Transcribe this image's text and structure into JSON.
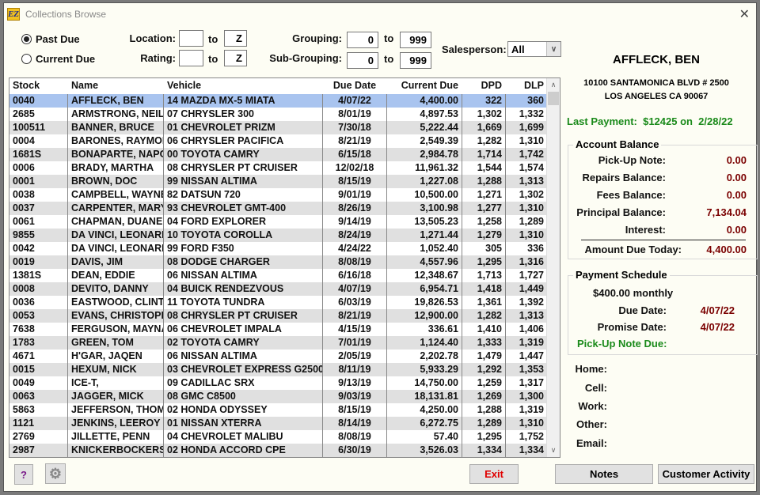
{
  "window": {
    "title": "Collections Browse",
    "logo_text": "EZ",
    "close": "✕"
  },
  "filters": {
    "past_due": "Past Due",
    "current_due": "Current Due",
    "selected": "past_due",
    "location_label": "Location:",
    "location_from": "",
    "location_to": "Z",
    "rating_label": "Rating:",
    "rating_from": "",
    "rating_to": "Z",
    "to": "to",
    "grouping_label": "Grouping:",
    "grouping_from": "0",
    "grouping_to": "999",
    "subgrouping_label": "Sub-Grouping:",
    "subgrouping_from": "0",
    "subgrouping_to": "999",
    "salesperson_label": "Salesperson:",
    "salesperson_value": "All"
  },
  "table": {
    "columns": [
      "Stock",
      "Name",
      "Vehicle",
      "Due Date",
      "Current Due",
      "DPD",
      "DLP"
    ],
    "selected_index": 0,
    "rows": [
      [
        "0040",
        "AFFLECK, BEN",
        "14 MAZDA MX-5 MIATA",
        "4/07/22",
        "4,400.00",
        "322",
        "360"
      ],
      [
        "2685",
        "ARMSTRONG, NEIL",
        "07 CHRYSLER 300",
        "8/01/19",
        "4,897.53",
        "1,302",
        "1,332"
      ],
      [
        "100511",
        "BANNER, BRUCE",
        "01 CHEVROLET PRIZM",
        "7/30/18",
        "5,222.44",
        "1,669",
        "1,699"
      ],
      [
        "0004",
        "BARONES, RAYMOND",
        "06 CHRYSLER PACIFICA",
        "8/21/19",
        "2,549.39",
        "1,282",
        "1,310"
      ],
      [
        "1681S",
        "BONAPARTE, NAPOLEON",
        "00 TOYOTA CAMRY",
        "6/15/18",
        "2,984.78",
        "1,714",
        "1,742"
      ],
      [
        "0006",
        "BRADY, MARTHA",
        "08 CHRYSLER PT CRUISER",
        "12/02/18",
        "11,961.32",
        "1,544",
        "1,574"
      ],
      [
        "0001",
        "BROWN, DOC",
        "99 NISSAN ALTIMA",
        "8/15/19",
        "1,227.08",
        "1,288",
        "1,313"
      ],
      [
        "0038",
        "CAMPBELL, WAYNE",
        "82 DATSUN 720",
        "9/01/19",
        "10,500.00",
        "1,271",
        "1,302"
      ],
      [
        "0037",
        "CARPENTER, MARY",
        "93 CHEVROLET GMT-400",
        "8/26/19",
        "3,100.98",
        "1,277",
        "1,310"
      ],
      [
        "0061",
        "CHAPMAN, DUANE",
        "04 FORD EXPLORER",
        "9/14/19",
        "13,505.23",
        "1,258",
        "1,289"
      ],
      [
        "9855",
        "DA VINCI, LEONARDO",
        "10 TOYOTA COROLLA",
        "8/24/19",
        "1,271.44",
        "1,279",
        "1,310"
      ],
      [
        "0042",
        "DA VINCI, LEONARDO",
        "99 FORD F350",
        "4/24/22",
        "1,052.40",
        "305",
        "336"
      ],
      [
        "0019",
        "DAVIS, JIM",
        "08 DODGE CHARGER",
        "8/08/19",
        "4,557.96",
        "1,295",
        "1,316"
      ],
      [
        "1381S",
        "DEAN, EDDIE",
        "06 NISSAN ALTIMA",
        "6/16/18",
        "12,348.67",
        "1,713",
        "1,727"
      ],
      [
        "0008",
        "DEVITO, DANNY",
        "04 BUICK RENDEZVOUS",
        "4/07/19",
        "6,954.71",
        "1,418",
        "1,449"
      ],
      [
        "0036",
        "EASTWOOD, CLINT",
        "11 TOYOTA TUNDRA",
        "6/03/19",
        "19,826.53",
        "1,361",
        "1,392"
      ],
      [
        "0053",
        "EVANS, CHRISTOPHER",
        "08 CHRYSLER PT CRUISER",
        "8/21/19",
        "12,900.00",
        "1,282",
        "1,313"
      ],
      [
        "7638",
        "FERGUSON, MAYNARD",
        "06 CHEVROLET IMPALA",
        "4/15/19",
        "336.61",
        "1,410",
        "1,406"
      ],
      [
        "1783",
        "GREEN, TOM",
        "02 TOYOTA CAMRY",
        "7/01/19",
        "1,124.40",
        "1,333",
        "1,319"
      ],
      [
        "4671",
        "H'GAR, JAQEN",
        "06 NISSAN ALTIMA",
        "2/05/19",
        "2,202.78",
        "1,479",
        "1,447"
      ],
      [
        "0015",
        "HEXUM, NICK",
        "03 CHEVROLET EXPRESS G2500",
        "8/11/19",
        "5,933.29",
        "1,292",
        "1,353"
      ],
      [
        "0049",
        "ICE-T,",
        "09 CADILLAC SRX",
        "9/13/19",
        "14,750.00",
        "1,259",
        "1,317"
      ],
      [
        "0063",
        "JAGGER, MICK",
        "08 GMC C8500",
        "9/03/19",
        "18,131.81",
        "1,269",
        "1,300"
      ],
      [
        "5863",
        "JEFFERSON, THOMAS",
        "02 HONDA ODYSSEY",
        "8/15/19",
        "4,250.00",
        "1,288",
        "1,319"
      ],
      [
        "1121",
        "JENKINS, LEEROY",
        "01 NISSAN XTERRA",
        "8/14/19",
        "6,272.75",
        "1,289",
        "1,310"
      ],
      [
        "2769",
        "JILLETTE, PENN",
        "04 CHEVROLET MALIBU",
        "8/08/19",
        "57.40",
        "1,295",
        "1,752"
      ],
      [
        "2987",
        "KNICKERBOCKERSC",
        "02 HONDA ACCORD CPE",
        "6/30/19",
        "3,526.03",
        "1,334",
        "1,334"
      ]
    ]
  },
  "customer": {
    "name": "AFFLECK, BEN",
    "address1": "10100 SANTAMONICA BLVD # 2500",
    "address2": "LOS ANGELES CA 90067",
    "last_payment": "Last Payment:  $12425 on  2/28/22"
  },
  "balance": {
    "title": "Account Balance",
    "items": [
      {
        "label": "Pick-Up Note:",
        "value": "0.00"
      },
      {
        "label": "Repairs Balance:",
        "value": "0.00"
      },
      {
        "label": "Fees Balance:",
        "value": "0.00"
      },
      {
        "label": "Principal Balance:",
        "value": "7,134.04"
      },
      {
        "label": "Interest:",
        "value": "0.00"
      }
    ],
    "total_label": "Amount Due Today:",
    "total_value": "4,400.00"
  },
  "schedule": {
    "title": "Payment Schedule",
    "amount": "$400.00 monthly",
    "due_label": "Due Date:",
    "due_value": "4/07/22",
    "promise_label": "Promise Date:",
    "promise_value": "4/07/22",
    "pickup_label": "Pick-Up Note Due:"
  },
  "contact": {
    "home": "Home:",
    "cell": "Cell:",
    "work": "Work:",
    "other": "Other:",
    "email": "Email:"
  },
  "buttons": {
    "help": "?",
    "settings_icon": "gear-icon",
    "exit": "Exit",
    "notes": "Notes",
    "activity": "Customer Activity"
  },
  "colors": {
    "selected_row": "#a9c4ef",
    "alt_row": "#e0e0e0",
    "money": "#7a0000",
    "green": "#1a8a1a",
    "exit": "#e00000"
  }
}
